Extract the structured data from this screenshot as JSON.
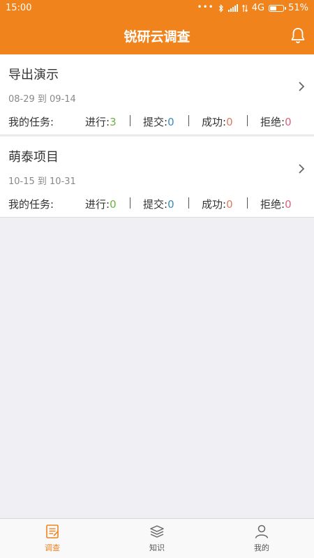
{
  "status_bar": {
    "time": "15:00",
    "network": "4G",
    "battery": "51%",
    "icons": [
      "dots-icon",
      "bluetooth-icon",
      "signal-icon",
      "data-arrows-icon",
      "battery-icon"
    ]
  },
  "header": {
    "title": "锐研云调查",
    "bell_icon": "bell-icon"
  },
  "colors": {
    "accent": "#f0831c",
    "progress": "#6ab33f",
    "submit": "#3a8bbd",
    "success": "#e07a5f",
    "reject": "#e0607e"
  },
  "projects": [
    {
      "name": "导出演示",
      "date": "08-29 到 09-14",
      "tasks_label": "我的任务:",
      "in_progress_label": "进行:",
      "in_progress": "3",
      "submitted_label": "提交:",
      "submitted": "0",
      "success_label": "成功:",
      "success": "0",
      "rejected_label": "拒绝:",
      "rejected": "0"
    },
    {
      "name": "萌泰项目",
      "date": "10-15 到 10-31",
      "tasks_label": "我的任务:",
      "in_progress_label": "进行:",
      "in_progress": "0",
      "submitted_label": "提交:",
      "submitted": "0",
      "success_label": "成功:",
      "success": "0",
      "rejected_label": "拒绝:",
      "rejected": "0"
    }
  ],
  "tabs": [
    {
      "label": "调查",
      "icon": "survey-icon",
      "active": true
    },
    {
      "label": "知识",
      "icon": "books-icon",
      "active": false
    },
    {
      "label": "我的",
      "icon": "user-icon",
      "active": false
    }
  ]
}
